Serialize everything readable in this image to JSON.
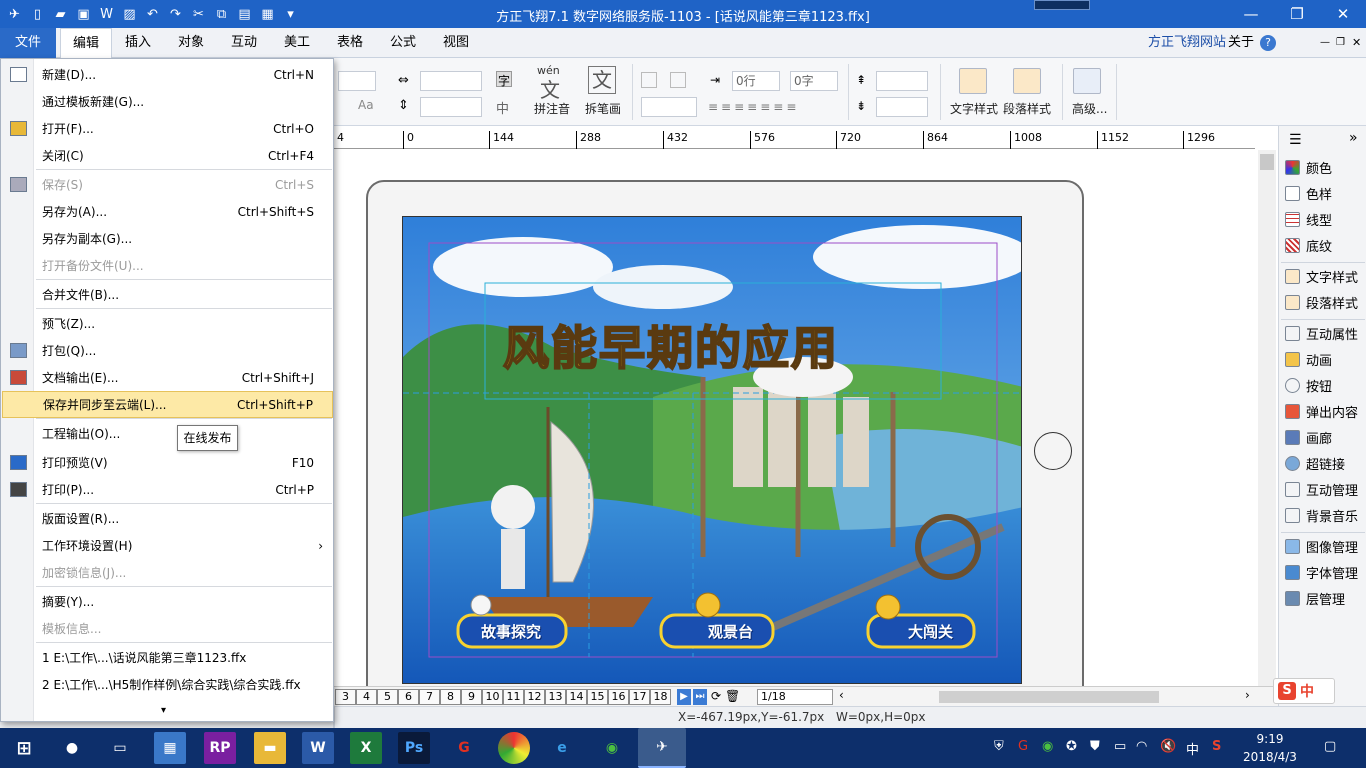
{
  "window": {
    "title": "方正飞翔7.1 数字网络服务版-1103 - [话说风能第三章1123.ffx]",
    "minimize": "—",
    "restore": "❐",
    "close": "✕"
  },
  "menubar": {
    "tabs": [
      "文件",
      "编辑",
      "插入",
      "对象",
      "互动",
      "美工",
      "表格",
      "公式",
      "视图"
    ],
    "site_link": "方正飞翔网站",
    "about": "关于"
  },
  "ribbon": {
    "field1": "0行",
    "field2": "0字",
    "pinyin_label": "拼注音",
    "pinyin_glyph": "文",
    "pinyin_top": "wén",
    "split_label": "拆笔画",
    "split_glyph": "文",
    "zi_glyph": "字",
    "zhong_glyph": "中",
    "aa_label": "Aa",
    "text_style": "文字样式",
    "para_style": "段落样式",
    "advanced": "高级..."
  },
  "ruler": {
    "ticks": [
      "4",
      "0",
      "144",
      "288",
      "432",
      "576",
      "720",
      "864",
      "1008",
      "1152",
      "1296"
    ]
  },
  "file_menu": {
    "items": [
      {
        "label": "新建(D)...",
        "shortcut": "Ctrl+N",
        "disabled": false
      },
      {
        "label": "通过模板新建(G)...",
        "shortcut": "",
        "disabled": false
      },
      {
        "label": "打开(F)...",
        "shortcut": "Ctrl+O",
        "disabled": false
      },
      {
        "label": "关闭(C)",
        "shortcut": "Ctrl+F4",
        "disabled": false
      },
      {
        "label": "保存(S)",
        "shortcut": "Ctrl+S",
        "disabled": true
      },
      {
        "label": "另存为(A)...",
        "shortcut": "Ctrl+Shift+S",
        "disabled": false
      },
      {
        "label": "另存为副本(G)...",
        "shortcut": "",
        "disabled": false
      },
      {
        "label": "打开备份文件(U)...",
        "shortcut": "",
        "disabled": true
      },
      {
        "label": "合并文件(B)...",
        "shortcut": "",
        "disabled": false
      },
      {
        "label": "预飞(Z)...",
        "shortcut": "",
        "disabled": false
      },
      {
        "label": "打包(Q)...",
        "shortcut": "",
        "disabled": false
      },
      {
        "label": "文档输出(E)...",
        "shortcut": "Ctrl+Shift+J",
        "disabled": false
      },
      {
        "label": "保存并同步至云端(L)...",
        "shortcut": "Ctrl+Shift+P",
        "disabled": false
      },
      {
        "label": "工程输出(O)...",
        "shortcut": "",
        "disabled": false
      },
      {
        "label": "打印预览(V)",
        "shortcut": "F10",
        "disabled": false
      },
      {
        "label": "打印(P)...",
        "shortcut": "Ctrl+P",
        "disabled": false
      },
      {
        "label": "版面设置(R)...",
        "shortcut": "",
        "disabled": false
      },
      {
        "label": "工作环境设置(H)",
        "shortcut": "",
        "disabled": false
      },
      {
        "label": "加密锁信息(J)...",
        "shortcut": "",
        "disabled": true
      },
      {
        "label": "摘要(Y)...",
        "shortcut": "",
        "disabled": false
      },
      {
        "label": "模板信息...",
        "shortcut": "",
        "disabled": true
      },
      {
        "label": "1 E:\\工作\\...\\话说风能第三章1123.ffx",
        "shortcut": "",
        "disabled": false
      },
      {
        "label": "2 E:\\工作\\...\\H5制作样例\\综合实践\\综合实践.ffx",
        "shortcut": "",
        "disabled": false
      }
    ],
    "submenu_arrow": "›",
    "more_arrow": "▾"
  },
  "tooltip": "在线发布",
  "canvas": {
    "title": "风能早期的应用",
    "btn1": "故事探究",
    "btn2": "观景台",
    "btn3": "大闯关"
  },
  "pagebar": {
    "pages": [
      "3",
      "4",
      "5",
      "6",
      "7",
      "8",
      "9",
      "10",
      "11",
      "12",
      "13",
      "14",
      "15",
      "16",
      "17",
      "18"
    ],
    "page_field": "1/18"
  },
  "status": {
    "coords": "X=-467.19px,Y=-61.7px",
    "size": "W=0px,H=0px"
  },
  "right_panel": {
    "items": [
      "颜色",
      "色样",
      "线型",
      "底纹",
      "文字样式",
      "段落样式",
      "互动属性",
      "动画",
      "按钮",
      "弹出内容",
      "画廊",
      "超链接",
      "互动管理",
      "背景音乐",
      "图像管理",
      "字体管理",
      "层管理"
    ]
  },
  "taskbar": {
    "ime": "中",
    "time": "9:19",
    "date": "2018/4/3"
  },
  "colors": {
    "title_bar": "#1f63c6",
    "menu_highlight": "#fde9a6",
    "taskbar": "#0d2f6b"
  }
}
